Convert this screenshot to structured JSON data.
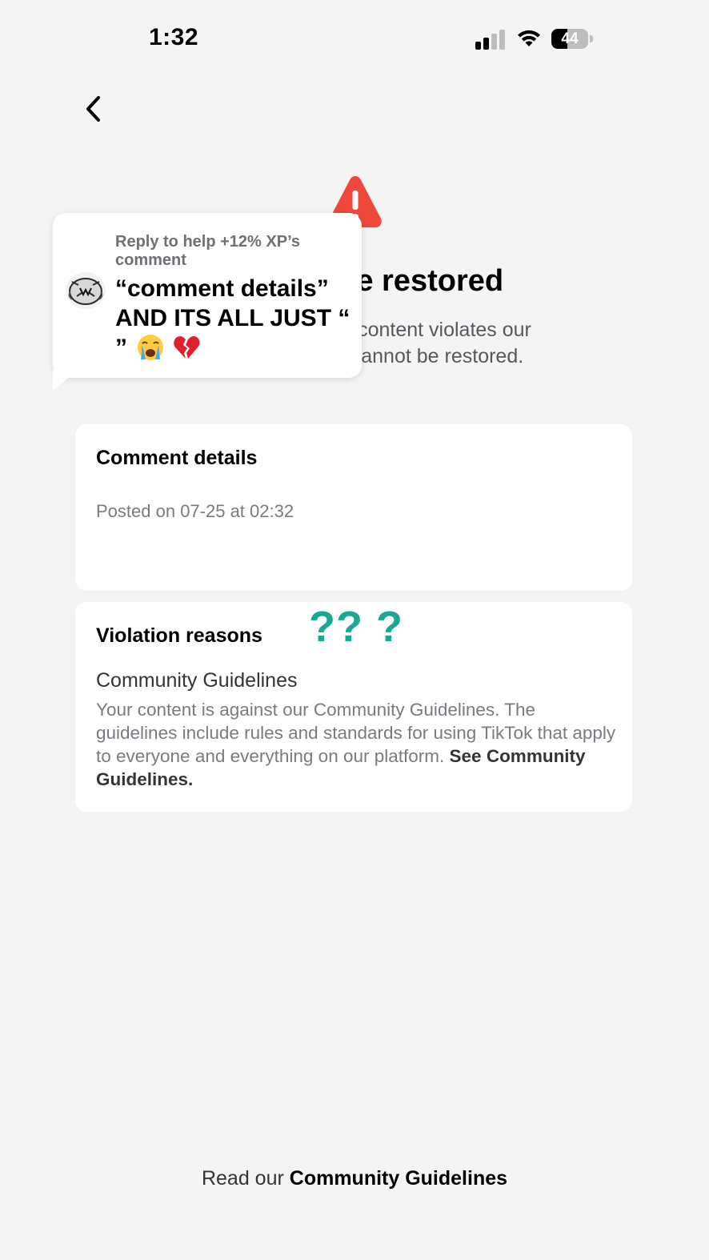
{
  "status_bar": {
    "time": "1:32",
    "battery_level": "44",
    "battery_fraction": 0.44,
    "signal_bars_active": 2,
    "signal_bars_total": 4
  },
  "header": {
    "back_icon": "chevron-left-icon"
  },
  "notice": {
    "icon": "warning-triangle-icon",
    "icon_color": "#f0473b",
    "title_visible": "t be restored",
    "subtitle_line1": "our content violates our",
    "subtitle_line2": "nd cannot be restored."
  },
  "reply_sticker": {
    "meta": "Reply to help +12% XP’s comment",
    "body": "“comment details” AND ITS ALL JUST “ ”",
    "emojis": [
      "loudly-crying-face",
      "broken-heart"
    ]
  },
  "comment_card": {
    "title": "Comment details",
    "posted": "Posted on 07-25 at 02:32"
  },
  "violation_card": {
    "title": "Violation reasons",
    "annotation": "?? ?",
    "annotation_color": "#1aa894",
    "reason_title": "Community Guidelines",
    "reason_desc": "Your content is against our Community Guidelines. The guidelines include rules and standards for using TikTok that apply to everyone and everything on our platform.",
    "reason_link": "See Community Guidelines."
  },
  "footer": {
    "prefix": "Read our",
    "link": "Community Guidelines"
  }
}
